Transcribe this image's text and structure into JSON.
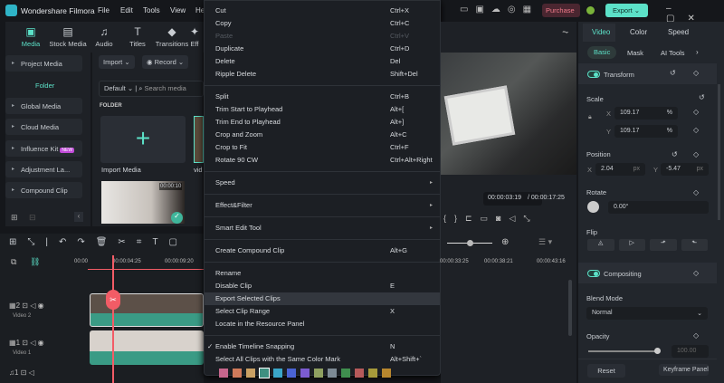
{
  "app": {
    "title": "Wondershare Filmora",
    "menus": [
      "File",
      "Edit",
      "Tools",
      "View",
      "He"
    ],
    "purchase": "Purchase",
    "export": "Export"
  },
  "toolbar_tabs": [
    {
      "label": "Media",
      "icon": "media-icon"
    },
    {
      "label": "Stock Media",
      "icon": "stock-media-icon"
    },
    {
      "label": "Audio",
      "icon": "music-note-icon"
    },
    {
      "label": "Titles",
      "icon": "text-icon"
    },
    {
      "label": "Transitions",
      "icon": "transition-icon"
    },
    {
      "label": "Eff",
      "icon": "effects-icon"
    }
  ],
  "left_nav": {
    "project_media": "Project Media",
    "folder": "Folder",
    "items": [
      "Global Media",
      "Cloud Media",
      "Influence Kit",
      "Adjustment La...",
      "Compound Clip"
    ],
    "new_badge": "NEW"
  },
  "media": {
    "import": "Import",
    "record": "Record",
    "sort": "Default",
    "search_placeholder": "Search media",
    "folder_label": "FOLDER",
    "import_media": "Import Media",
    "clip_name": "vid",
    "clip_duration": "00:00:10"
  },
  "context_menu": {
    "groups": [
      [
        {
          "label": "Cut",
          "shortcut": "Ctrl+X"
        },
        {
          "label": "Copy",
          "shortcut": "Ctrl+C"
        },
        {
          "label": "Paste",
          "shortcut": "Ctrl+V",
          "disabled": true
        },
        {
          "label": "Duplicate",
          "shortcut": "Ctrl+D"
        },
        {
          "label": "Delete",
          "shortcut": "Del"
        },
        {
          "label": "Ripple Delete",
          "shortcut": "Shift+Del"
        }
      ],
      [
        {
          "label": "Split",
          "shortcut": "Ctrl+B"
        },
        {
          "label": "Trim Start to Playhead",
          "shortcut": "Alt+["
        },
        {
          "label": "Trim End to Playhead",
          "shortcut": "Alt+]"
        },
        {
          "label": "Crop and Zoom",
          "shortcut": "Alt+C"
        },
        {
          "label": "Crop to Fit",
          "shortcut": "Ctrl+F"
        },
        {
          "label": "Rotate 90 CW",
          "shortcut": "Ctrl+Alt+Right"
        }
      ],
      [
        {
          "label": "Speed",
          "submenu": true
        }
      ],
      [
        {
          "label": "Effect&Filter",
          "submenu": true
        }
      ],
      [
        {
          "label": "Smart Edit Tool",
          "submenu": true
        }
      ],
      [
        {
          "label": "Create Compound Clip",
          "shortcut": "Alt+G"
        }
      ],
      [
        {
          "label": "Rename"
        },
        {
          "label": "Disable Clip",
          "shortcut": "E"
        },
        {
          "label": "Export Selected Clips",
          "highlighted": true
        },
        {
          "label": "Select Clip Range",
          "shortcut": "X"
        },
        {
          "label": "Locate in the Resource Panel"
        }
      ],
      [
        {
          "label": "Enable Timeline Snapping",
          "shortcut": "N",
          "checked": true
        },
        {
          "label": "Select All Clips with the Same Color Mark",
          "shortcut": "Alt+Shift+`"
        }
      ]
    ],
    "color_marks": [
      "#c6668c",
      "#d07a5a",
      "#c9a063",
      "#3f8f80",
      "#3aa6c8",
      "#4a63d3",
      "#7b5bd0",
      "#8fa060",
      "#7d8a94",
      "#3f8e4e",
      "#b65a5a",
      "#a69a3a",
      "#b8872e"
    ],
    "selected_color_index": 3
  },
  "preview": {
    "current_time": "00:00:03:19",
    "total_time": "/ 00:00:17:25"
  },
  "timeline": {
    "ruler": [
      "00:00",
      "00:00:04:25",
      "00:00:09:20",
      "00:00:33:25",
      "00:00:38:21",
      "00:00:43:16"
    ],
    "tracks": [
      {
        "num": "2",
        "name": "Video 2"
      },
      {
        "num": "1",
        "name": "Video 1"
      },
      {
        "num": "1",
        "name": ""
      }
    ]
  },
  "properties": {
    "tabs": [
      "Video",
      "Color",
      "Speed"
    ],
    "subtabs": [
      "Basic",
      "Mask",
      "AI Tools"
    ],
    "transform": "Transform",
    "scale": "Scale",
    "scale_x": "109.17",
    "scale_y": "109.17",
    "pct": "%",
    "x": "X",
    "y": "Y",
    "position": "Position",
    "pos_x": "2.04",
    "pos_y": "-5.47",
    "px": "px",
    "rotate": "Rotate",
    "rotate_val": "0.00°",
    "flip": "Flip",
    "compositing": "Compositing",
    "blend_mode": "Blend Mode",
    "blend_value": "Normal",
    "opacity": "Opacity",
    "opacity_val": "100.00",
    "opacity_fraction": 1.0,
    "reset": "Reset",
    "keyframe_panel": "Keyframe Panel"
  }
}
